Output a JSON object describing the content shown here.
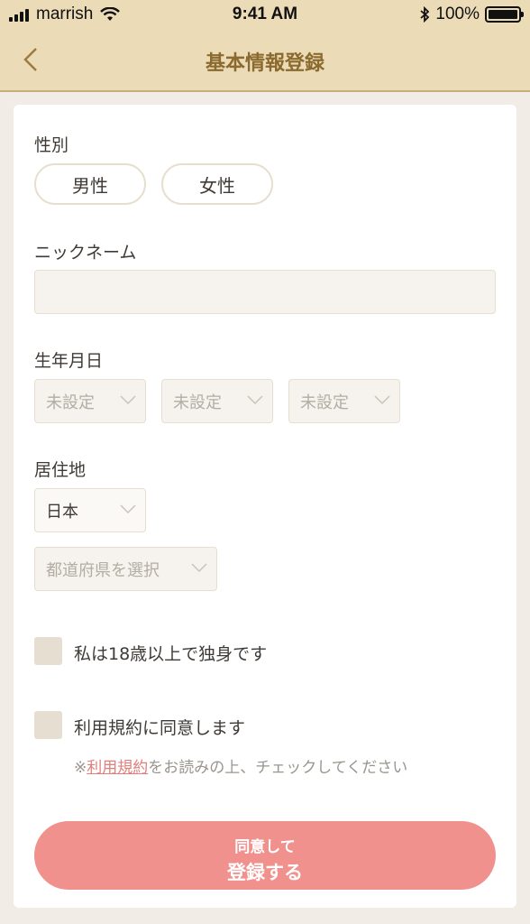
{
  "status_bar": {
    "carrier": "marrish",
    "time": "9:41 AM",
    "battery": "100%",
    "battery_level": 1.0
  },
  "header": {
    "title": "基本情報登録",
    "back_icon": "chevron-left-icon"
  },
  "form": {
    "gender": {
      "label": "性別",
      "options": [
        "男性",
        "女性"
      ]
    },
    "nickname": {
      "label": "ニックネーム",
      "value": ""
    },
    "birthday": {
      "label": "生年月日",
      "year": "未設定",
      "month": "未設定",
      "day": "未設定"
    },
    "residence": {
      "label": "居住地",
      "country": "日本",
      "prefecture": "都道府県を選択"
    },
    "age_check": {
      "label": "私は18歳以上で独身です"
    },
    "terms_check": {
      "label": "利用規約に同意します",
      "note_prefix": "※",
      "note_link": "利用規約",
      "note_suffix": "をお読みの上、チェックしてください"
    },
    "submit": {
      "line1": "同意して",
      "line2": "登録する"
    }
  },
  "colors": {
    "header_bg": "#ecdbb7",
    "title": "#8a6a2e",
    "accent": "#f0918e",
    "link": "#e07f7b"
  }
}
